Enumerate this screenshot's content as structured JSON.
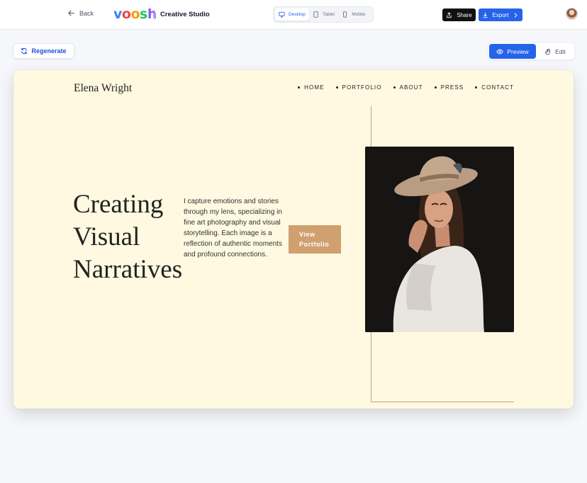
{
  "topbar": {
    "back_label": "Back",
    "logo_text": "voosh",
    "logo_colors": [
      "#3b82f6",
      "#ef4444",
      "#f59e0b",
      "#22c55e",
      "#8b5cf6"
    ],
    "app_title": "Creative Studio",
    "devices": [
      {
        "label": "Desktop",
        "icon": "monitor-icon",
        "active": true
      },
      {
        "label": "Tablet",
        "icon": "tablet-icon",
        "active": false
      },
      {
        "label": "Mobile",
        "icon": "phone-icon",
        "active": false
      }
    ],
    "share_label": "Share",
    "export_label": "Export"
  },
  "toolbar": {
    "regenerate_label": "Regenerate",
    "preview_label": "Preview",
    "edit_label": "Edit",
    "accent": "#2563eb"
  },
  "site": {
    "name": "Elena Wright",
    "nav": [
      "HOME",
      "PORTFOLIO",
      "ABOUT",
      "PRESS",
      "CONTACT"
    ],
    "headline": [
      "Creating",
      "Visual",
      "Narratives"
    ],
    "intro": "I capture emotions and stories through my lens, specializing in fine art photography and visual storytelling. Each image is a reflection of authentic moments and profound connections.",
    "cta": [
      "View",
      "Portfolio"
    ],
    "background": "#fef9e0",
    "cta_color": "#d0a06f"
  }
}
